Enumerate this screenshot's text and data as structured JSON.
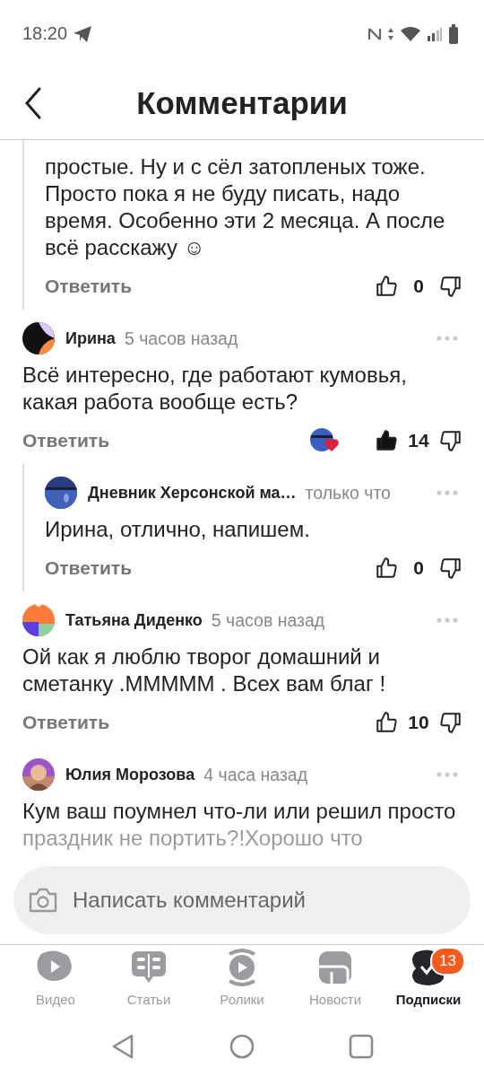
{
  "status_bar": {
    "time": "18:20"
  },
  "header": {
    "title": "Комментарии"
  },
  "comments": [
    {
      "kind": "reply",
      "text": "простые. Ну и с сёл затопленых тоже. Просто пока я не буду писать, надо время. Особенно эти 2 месяца. А после всё расскажу ☺",
      "reply_label": "Ответить",
      "likes": "0",
      "liked": false
    },
    {
      "kind": "comment",
      "avatar": {
        "kind": "blobs"
      },
      "author": "Ирина",
      "time": "5 часов назад",
      "text": "Всё интересно, где работают кумовья, какая работа вообще есть?",
      "reply_label": "Ответить",
      "reaction": true,
      "likes": "14",
      "liked": true
    },
    {
      "kind": "reply",
      "avatar": {
        "kind": "landscape"
      },
      "author": "Дневник Херсонской ма…",
      "time": "только что",
      "text": "Ирина, отлично, напишем.",
      "reply_label": "Ответить",
      "likes": "0",
      "liked": false
    },
    {
      "kind": "comment",
      "avatar": {
        "kind": "petals"
      },
      "author": "Татьяна Диденко",
      "time": "5 часов назад",
      "text": "Ой как я люблю творог домашний и сметанку .МММММ . Всех вам благ !",
      "reply_label": "Ответить",
      "likes": "10",
      "liked": false
    },
    {
      "kind": "comment",
      "avatar": {
        "kind": "person"
      },
      "author": "Юлия Морозова",
      "time": "4 часа назад",
      "text": "Кум ваш поумнел что-ли или решил просто праздник не портить?!Хорошо что",
      "truncated": true
    }
  ],
  "comment_field": {
    "placeholder": "Написать комментарий"
  },
  "bottom_nav": [
    {
      "kind": "video",
      "label": "Видео",
      "selected": false
    },
    {
      "kind": "articles",
      "label": "Статьи",
      "selected": false
    },
    {
      "kind": "clips",
      "label": "Ролики",
      "selected": false
    },
    {
      "kind": "news",
      "label": "Новости",
      "selected": false
    },
    {
      "kind": "subscriptions",
      "label": "Подписки",
      "selected": true,
      "badge": "13"
    }
  ]
}
